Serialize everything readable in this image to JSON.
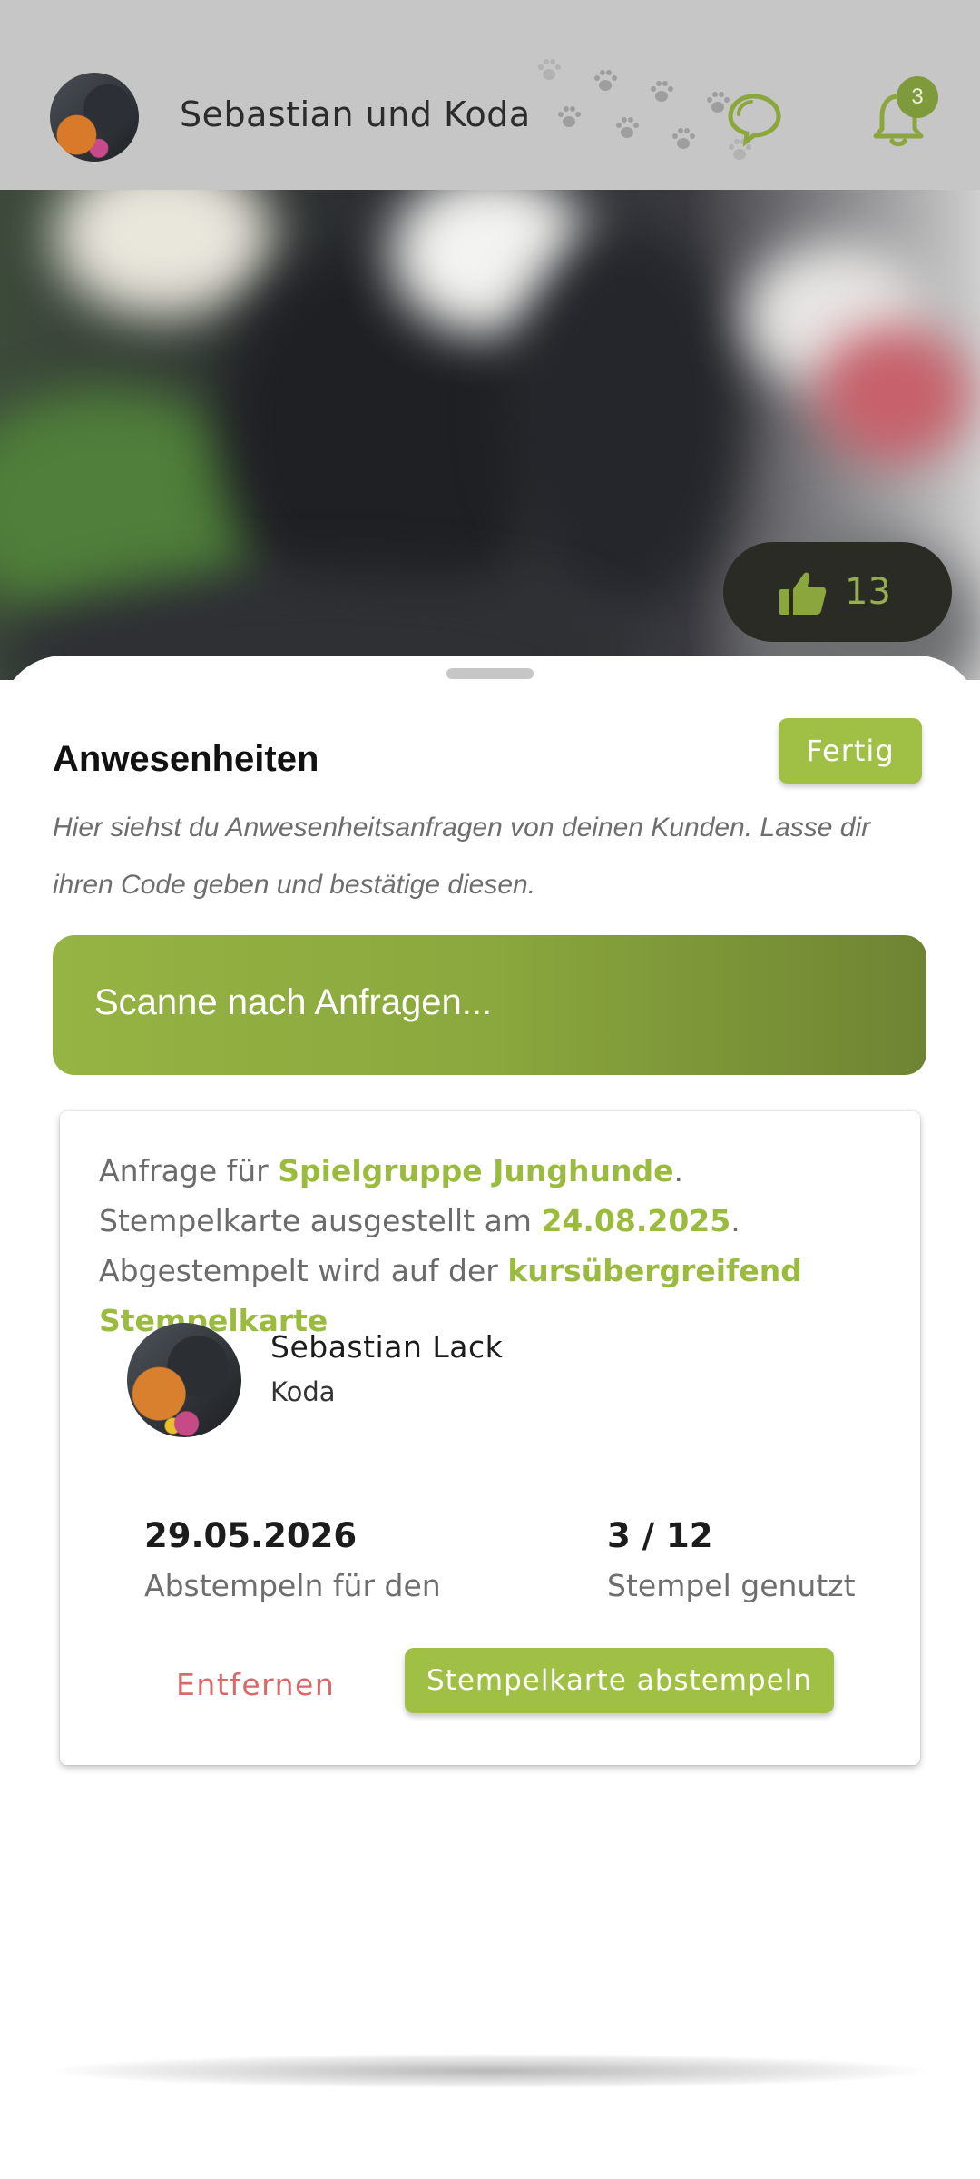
{
  "header": {
    "title": "Sebastian und Koda",
    "notification_count": "3",
    "avatar_icon": "user-avatar",
    "decoration_icon": "paw-prints",
    "chat_icon": "chat-bubbles",
    "bell_icon": "bell"
  },
  "hero": {
    "like_count": "13",
    "like_icon": "thumbs-up"
  },
  "sheet": {
    "title": "Anwesenheiten",
    "done_label": "Fertig",
    "description": "Hier siehst du Anwesenheitsanfragen von deinen Kunden. Lasse dir ihren Code geben und bestätige diesen.",
    "scan_label": "Scanne nach Anfragen..."
  },
  "request": {
    "text_prefix": "Anfrage für ",
    "course": "Spielgruppe Junghunde",
    "text_mid1": ". Stempelkarte ausgestellt am ",
    "issued_date": "24.08.2025",
    "text_mid2": ". Abgestempelt wird auf der ",
    "card_type": "kursübergreifend Stempelkarte",
    "customer_name": "Sebastian Lack",
    "dog_name": "Koda",
    "stamp_date": "29.05.2026",
    "stamp_date_label": "Abstempeln für den",
    "stamps_used": "3 / 12",
    "stamps_used_label": "Stempel genutzt",
    "remove_label": "Entfernen",
    "stamp_label": "Stempelkarte abstempeln"
  },
  "colors": {
    "accent": "#9fbf45",
    "accent_dark": "#6f8433",
    "header_bg": "#c6c6c6",
    "danger": "#d66a6a"
  }
}
